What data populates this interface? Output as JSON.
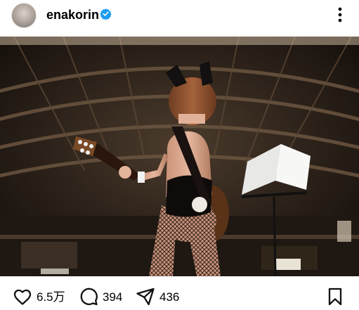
{
  "post": {
    "username": "enakorin",
    "verified": true
  },
  "actions": {
    "likes": "6.5万",
    "comments": "394",
    "shares": "436"
  },
  "icons": {
    "avatar": "profile-avatar",
    "verified": "verified-badge-icon",
    "more": "more-options-icon",
    "like": "heart-icon",
    "comment": "comment-bubble-icon",
    "share": "paper-plane-icon",
    "save": "bookmark-icon"
  },
  "colors": {
    "verified_badge": "#1d9bf0",
    "text": "#000000"
  }
}
